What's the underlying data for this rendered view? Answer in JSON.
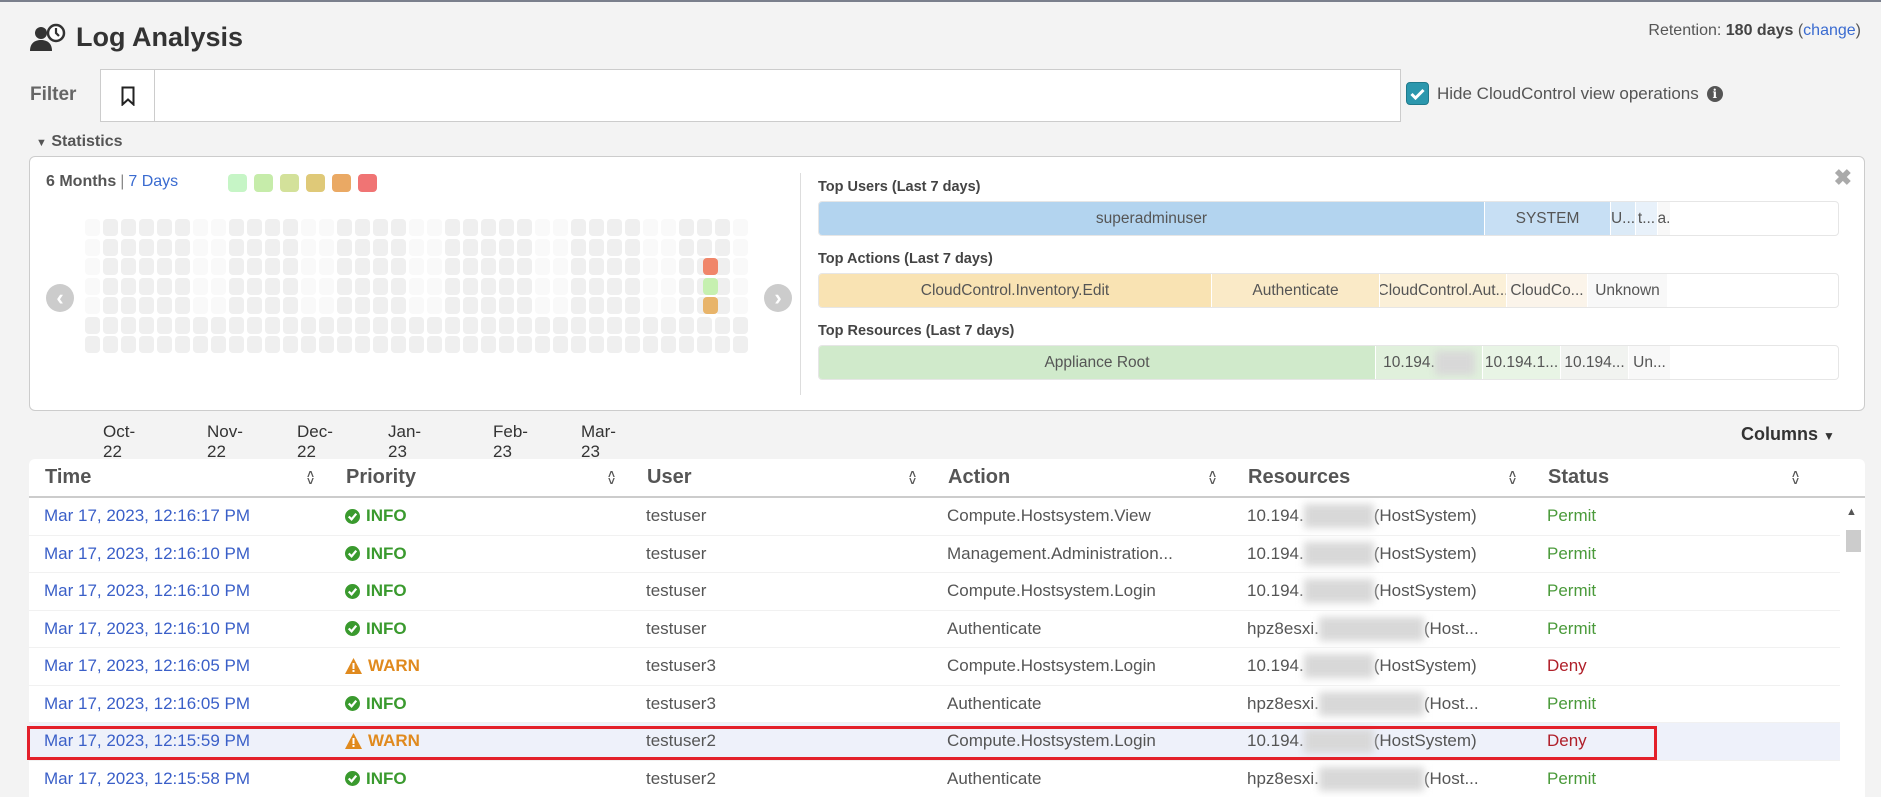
{
  "header": {
    "title": "Log Analysis",
    "icon": "users-clock-icon",
    "retention_label": "Retention:",
    "retention_value": "180 days",
    "retention_change": "change"
  },
  "filter": {
    "label": "Filter",
    "placeholder": "",
    "value": "",
    "hide_cc_label": "Hide CloudControl view operations",
    "hide_cc_checked": true
  },
  "statistics": {
    "toggle_label": "Statistics",
    "range_active": "6 Months",
    "range_sep": "|",
    "range_other": "7 Days",
    "legend_colors": [
      "#c6f5c6",
      "#c6ecaa",
      "#d3e19a",
      "#dfc978",
      "#eaa964",
      "#f07474"
    ],
    "months": [
      "Oct-22",
      "Nov-22",
      "Dec-22",
      "Jan-23",
      "Feb-23",
      "Mar-23"
    ],
    "highlighted_cells": [
      {
        "month": "Mar-23",
        "color": "#f0866a"
      },
      {
        "month": "Mar-23",
        "color": "#c6f0b0"
      },
      {
        "month": "Mar-23",
        "color": "#e8b46a"
      }
    ],
    "top_users": {
      "label": "Top Users (Last 7 days)",
      "segments": [
        {
          "text": "superadminuser",
          "color": "#b3d4ef"
        },
        {
          "text": "SYSTEM",
          "color": "#c7dff4"
        },
        {
          "text": "U...",
          "color": "#dbeaf7"
        },
        {
          "text": "t...",
          "color": "#e8f1fa"
        },
        {
          "text": "a.",
          "color": "#f8f8f8"
        }
      ]
    },
    "top_actions": {
      "label": "Top Actions (Last 7 days)",
      "segments": [
        {
          "text": "CloudControl.Inventory.Edit",
          "color": "#f9e3b3"
        },
        {
          "text": "Authenticate",
          "color": "#faeac7"
        },
        {
          "text": "CloudControl.Aut...",
          "color": "#fbf0d8"
        },
        {
          "text": "CloudCo...",
          "color": "#fbf4ea"
        },
        {
          "text": "Unknown",
          "color": "#f8f8f8"
        }
      ]
    },
    "top_resources": {
      "label": "Top Resources (Last 7 days)",
      "segments": [
        {
          "text": "Appliance Root",
          "color": "#d0eacb"
        },
        {
          "text": "10.194.",
          "color": "#e0f0dc"
        },
        {
          "text": "10.194.1...",
          "color": "#e8f4e5"
        },
        {
          "text": "10.194...",
          "color": "#f1f3f0"
        },
        {
          "text": "Un...",
          "color": "#f8f8f8"
        }
      ]
    }
  },
  "table": {
    "columns_button": "Columns",
    "headers": [
      "Time",
      "Priority",
      "User",
      "Action",
      "Resources",
      "Status"
    ],
    "rows": [
      {
        "time": "Mar 17, 2023, 12:16:17 PM",
        "priority": "INFO",
        "user": "testuser",
        "action": "Compute.Hostsystem.View",
        "res_prefix": "10.194.",
        "res_suffix": "(HostSystem)",
        "status": "Permit"
      },
      {
        "time": "Mar 17, 2023, 12:16:10 PM",
        "priority": "INFO",
        "user": "testuser",
        "action": "Management.Administration...",
        "res_prefix": "10.194.",
        "res_suffix": "(HostSystem)",
        "status": "Permit"
      },
      {
        "time": "Mar 17, 2023, 12:16:10 PM",
        "priority": "INFO",
        "user": "testuser",
        "action": "Compute.Hostsystem.Login",
        "res_prefix": "10.194.",
        "res_suffix": "(HostSystem)",
        "status": "Permit"
      },
      {
        "time": "Mar 17, 2023, 12:16:10 PM",
        "priority": "INFO",
        "user": "testuser",
        "action": "Authenticate",
        "res_prefix": "hpz8esxi.",
        "res_suffix": "(Host...",
        "status": "Permit"
      },
      {
        "time": "Mar 17, 2023, 12:16:05 PM",
        "priority": "WARN",
        "user": "testuser3",
        "action": "Compute.Hostsystem.Login",
        "res_prefix": "10.194.",
        "res_suffix": "(HostSystem)",
        "status": "Deny"
      },
      {
        "time": "Mar 17, 2023, 12:16:05 PM",
        "priority": "INFO",
        "user": "testuser3",
        "action": "Authenticate",
        "res_prefix": "hpz8esxi.",
        "res_suffix": "(Host...",
        "status": "Permit"
      },
      {
        "time": "Mar 17, 2023, 12:15:59 PM",
        "priority": "WARN",
        "user": "testuser2",
        "action": "Compute.Hostsystem.Login",
        "res_prefix": "10.194.",
        "res_suffix": "(HostSystem)",
        "status": "Deny",
        "selected": true
      },
      {
        "time": "Mar 17, 2023, 12:15:58 PM",
        "priority": "INFO",
        "user": "testuser2",
        "action": "Authenticate",
        "res_prefix": "hpz8esxi.",
        "res_suffix": "(Host...",
        "status": "Permit"
      }
    ],
    "colors": {
      "INFO": "#3a9a2e",
      "WARN": "#e08a1e",
      "Permit": "#4a9a3a",
      "Deny": "#b0202a"
    }
  }
}
